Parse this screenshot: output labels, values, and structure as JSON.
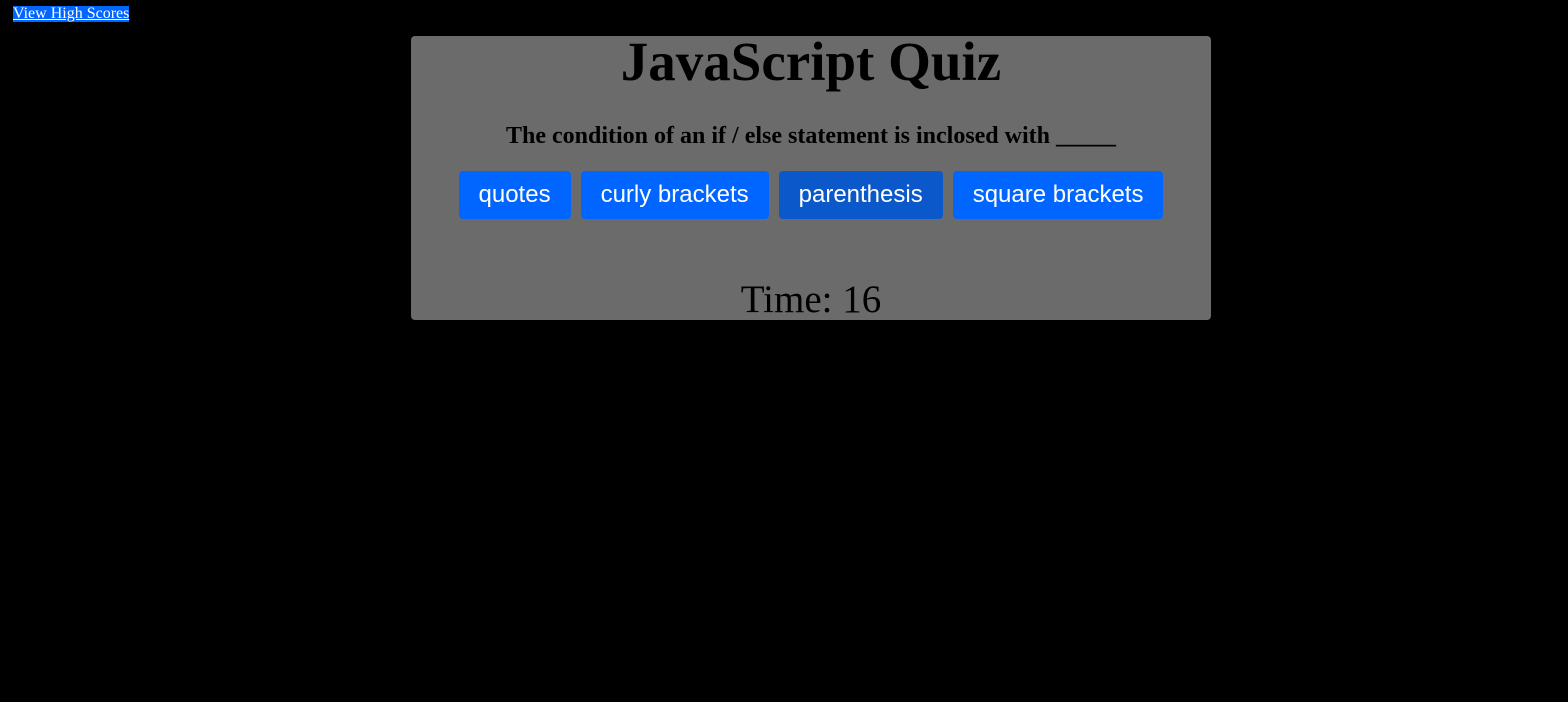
{
  "nav": {
    "high_scores_label": "View High Scores"
  },
  "quiz": {
    "title": "JavaScript Quiz",
    "question": "The condition of an if / else statement is inclosed with _____",
    "answers": [
      {
        "label": "quotes"
      },
      {
        "label": "curly brackets"
      },
      {
        "label": "parenthesis",
        "state": "hover"
      },
      {
        "label": "square brackets"
      }
    ],
    "timer_text": "Time: 16"
  },
  "colors": {
    "page_background": "#000000",
    "card_background": "#6b6b6b",
    "button_primary": "#0066ff",
    "button_hover": "#0a58ca",
    "button_text": "#ffffff"
  }
}
